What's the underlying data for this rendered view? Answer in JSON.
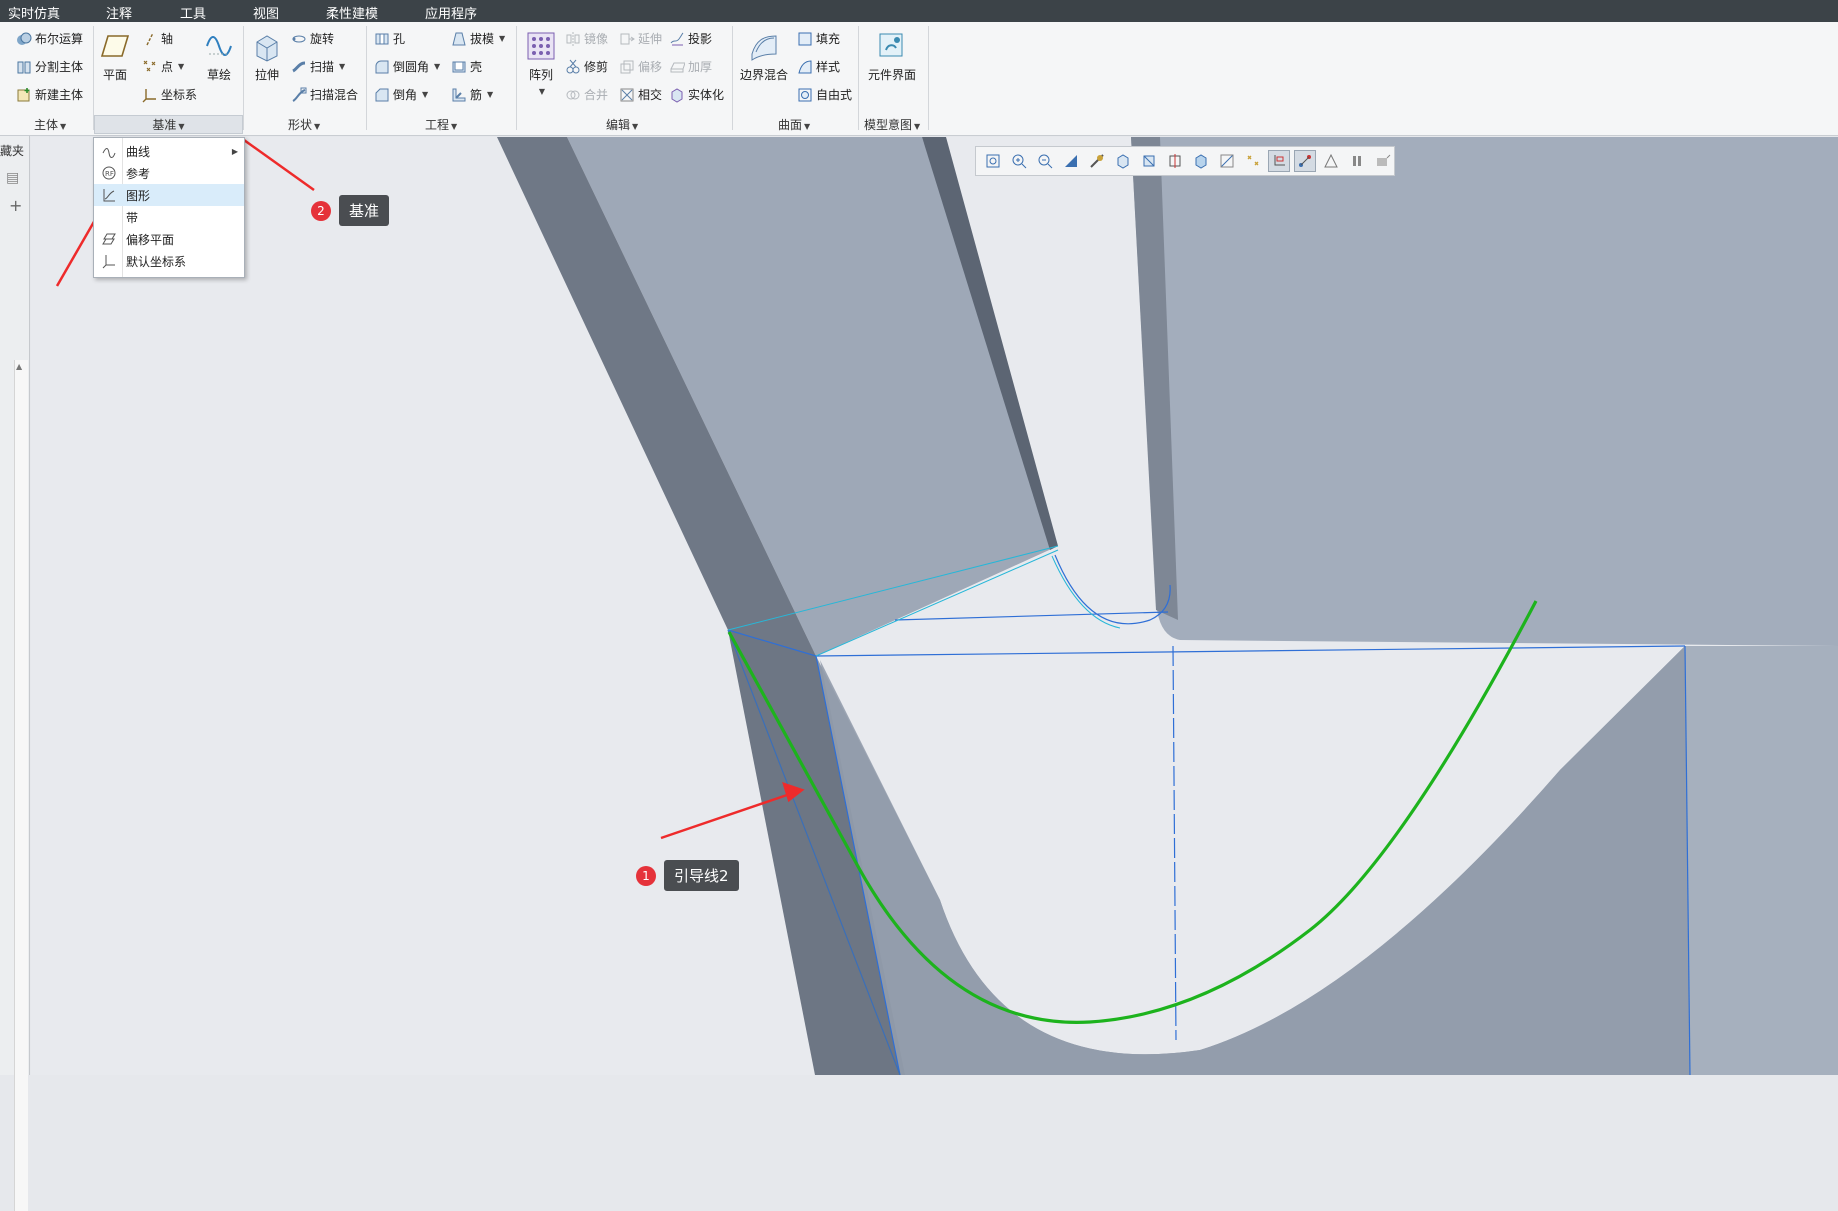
{
  "menubar": {
    "items": [
      "实时仿真",
      "注释",
      "工具",
      "视图",
      "柔性建模",
      "应用程序"
    ]
  },
  "ribbon": {
    "body_group": {
      "items": [
        "布尔运算",
        "分割主体",
        "新建主体"
      ],
      "label": "主体"
    },
    "datum_group": {
      "plane": "平面",
      "axis": "轴",
      "point": "点",
      "csys": "坐标系",
      "sketch": "草绘",
      "label": "基准"
    },
    "shape_group": {
      "extrude": "拉伸",
      "revolve": "旋转",
      "sweep": "扫描",
      "swept_blend": "扫描混合",
      "label": "形状"
    },
    "engineering_group": {
      "hole": "孔",
      "round": "倒圆角",
      "chamfer": "倒角",
      "draft": "拔模",
      "shell": "壳",
      "rib": "筋",
      "label": "工程"
    },
    "edit_group": {
      "pattern": "阵列",
      "mirror": "镜像",
      "extend": "延伸",
      "project": "投影",
      "trim": "修剪",
      "offset": "偏移",
      "thicken": "加厚",
      "merge": "合并",
      "intersect": "相交",
      "solidify": "实体化",
      "label": "编辑"
    },
    "surface_group": {
      "boundary_blend": "边界混合",
      "fill": "填充",
      "style": "样式",
      "freestyle": "自由式",
      "label": "曲面"
    },
    "model_intent_group": {
      "component_interface": "元件界面",
      "label": "模型意图"
    }
  },
  "leftpanel": {
    "tab": "藏夹"
  },
  "dropdown": {
    "items": [
      "曲线",
      "参考",
      "图形",
      "带",
      "偏移平面",
      "默认坐标系"
    ],
    "highlighted_index": 2
  },
  "callouts": [
    {
      "number": "1",
      "text": "引导线2"
    },
    {
      "number": "2",
      "text": "基准"
    }
  ],
  "colors": {
    "accent_green": "#1db31d",
    "edge_blue": "#2f6fd6",
    "callout_red": "#e5323a",
    "arrow_red": "#ee2b2b",
    "highlight": "#d9ecfa"
  }
}
